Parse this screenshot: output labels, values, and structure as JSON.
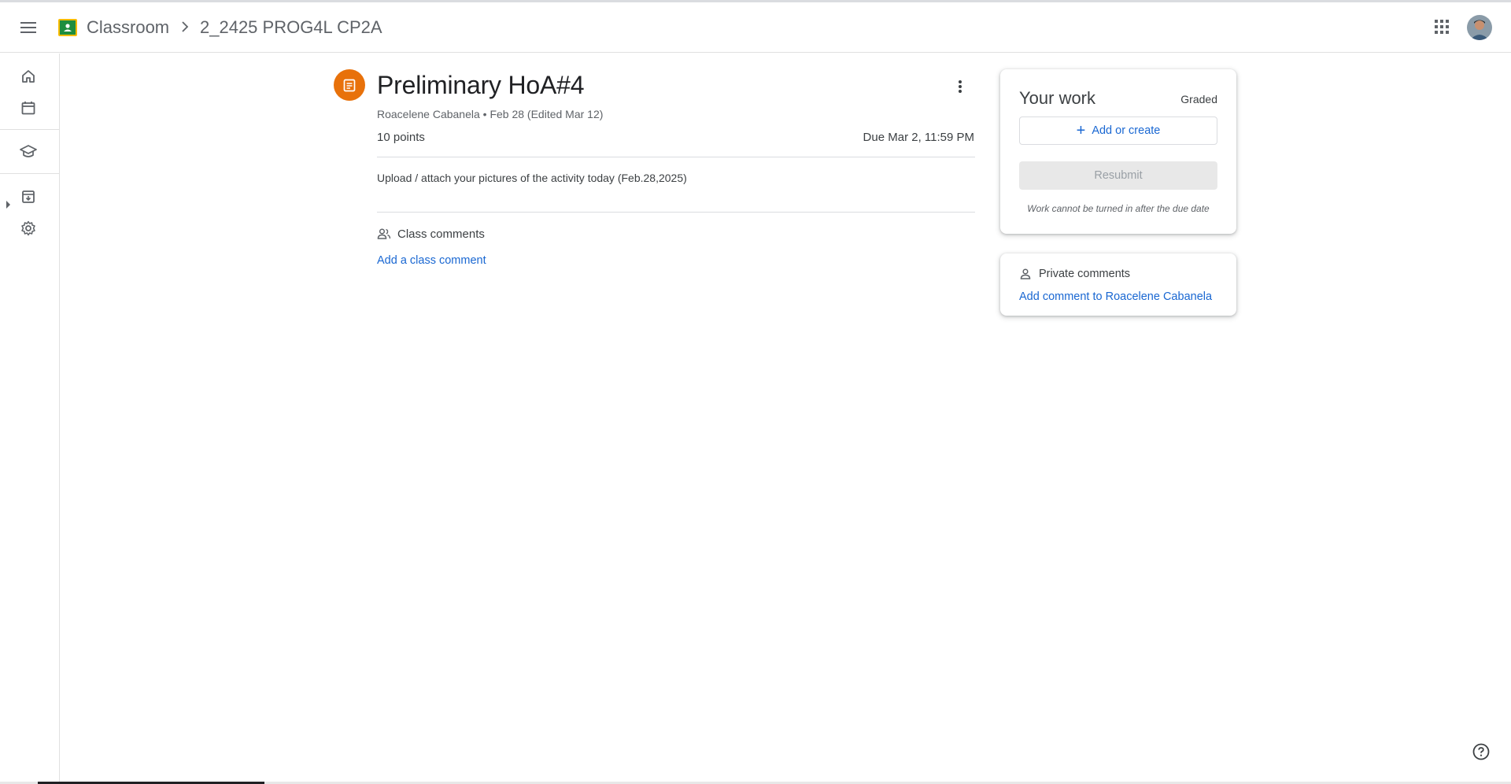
{
  "header": {
    "app_title": "Classroom",
    "breadcrumb_class": "2_2425 PROG4L CP2A",
    "icons": {
      "menu": "hamburger-menu-icon",
      "apps": "google-apps-grid-icon",
      "account": "account-avatar"
    }
  },
  "rail": {
    "items": [
      {
        "name": "home",
        "icon": "home-icon"
      },
      {
        "name": "calendar",
        "icon": "calendar-icon"
      },
      {
        "name": "enrolled",
        "icon": "school-cap-icon"
      },
      {
        "name": "archived",
        "icon": "archive-icon"
      },
      {
        "name": "settings",
        "icon": "gear-icon"
      }
    ]
  },
  "assignment": {
    "title": "Preliminary HoA#4",
    "meta": "Roacelene Cabanela • Feb 28 (Edited Mar 12)",
    "points": "10 points",
    "due": "Due Mar 2, 11:59 PM",
    "description": "Upload / attach your pictures of the activity today (Feb.28,2025)",
    "class_comments_label": "Class comments",
    "add_class_comment": "Add a class comment",
    "icon_color": "#e8710a"
  },
  "your_work": {
    "title": "Your work",
    "status": "Graded",
    "add_label": "Add or create",
    "resubmit_label": "Resubmit",
    "note": "Work cannot be turned in after the due date"
  },
  "private_comments": {
    "label": "Private comments",
    "add_label": "Add comment to Roacelene Cabanela"
  },
  "colors": {
    "link": "#1967d2",
    "brand_green": "#1e8e3e",
    "brand_yellow": "#fbbc04"
  }
}
